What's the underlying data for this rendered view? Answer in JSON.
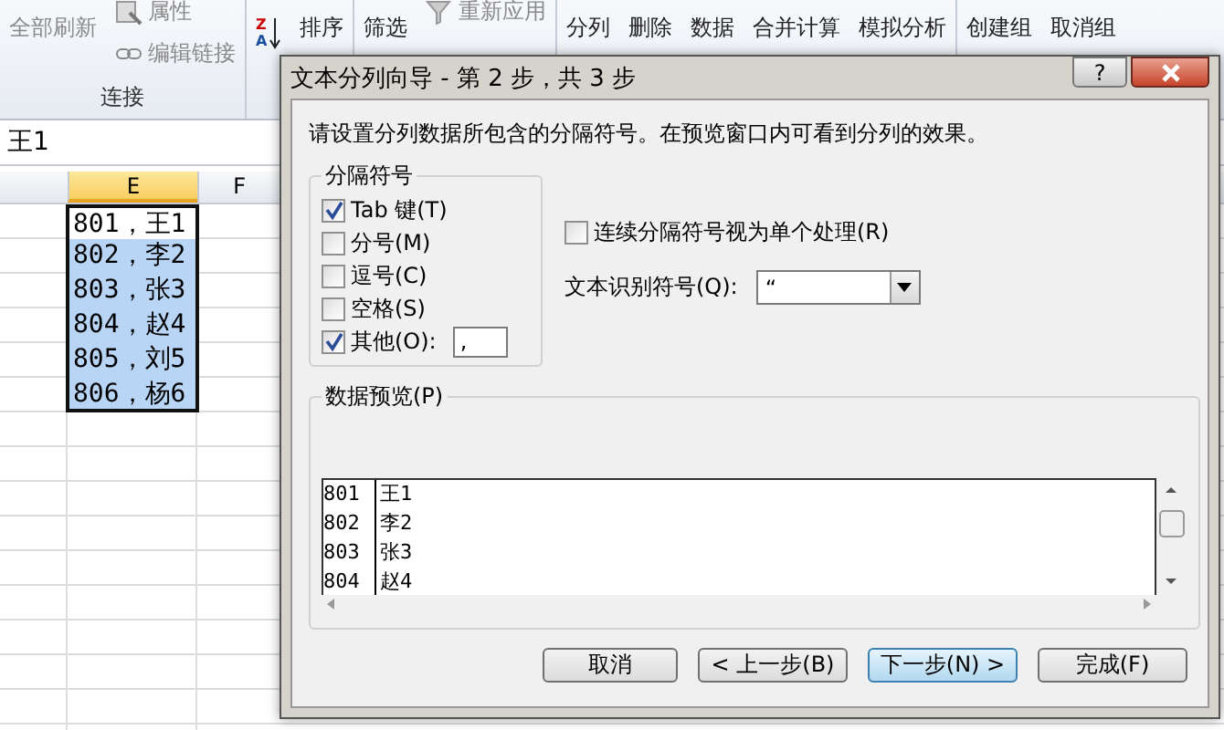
{
  "ribbon": {
    "groups": [
      {
        "label": "连接",
        "items": [
          {
            "kind": "large",
            "label": "全部刷新",
            "disabled": true
          },
          {
            "kind": "stack",
            "items": [
              {
                "label": "属性",
                "disabled": true
              },
              {
                "label": "编辑链接",
                "disabled": true
              }
            ]
          }
        ]
      },
      {
        "items": [
          {
            "kind": "sorticon",
            "top": "Z",
            "bottom": "A"
          },
          {
            "kind": "large",
            "label": "排序",
            "disabled": false
          }
        ]
      },
      {
        "items": [
          {
            "kind": "large",
            "label": "筛选",
            "disabled": false
          },
          {
            "kind": "stack",
            "items": [
              {
                "label": "重新应用",
                "disabled": true
              }
            ]
          }
        ]
      },
      {
        "items": [
          {
            "kind": "large",
            "label": "分列",
            "disabled": false
          },
          {
            "kind": "large",
            "label": "删除",
            "disabled": false
          },
          {
            "kind": "large",
            "label": "数据",
            "disabled": false
          },
          {
            "kind": "large",
            "label": "合并计算",
            "disabled": false
          },
          {
            "kind": "large",
            "label": "模拟分析",
            "disabled": false
          }
        ]
      },
      {
        "items": [
          {
            "kind": "large",
            "label": "创建组",
            "disabled": false
          },
          {
            "kind": "large",
            "label": "取消组",
            "disabled": false
          }
        ]
      }
    ]
  },
  "formula_bar": {
    "value": "王1"
  },
  "sheet": {
    "columns": [
      {
        "label": "E",
        "selected": true
      },
      {
        "label": "F",
        "selected": false
      }
    ],
    "cells": [
      {
        "text": "801，王1",
        "active": true
      },
      {
        "text": "802，李2",
        "active": false
      },
      {
        "text": "803，张3",
        "active": false
      },
      {
        "text": "804，赵4",
        "active": false
      },
      {
        "text": "805，刘5",
        "active": false
      },
      {
        "text": "806，杨6",
        "active": false
      }
    ]
  },
  "dialog": {
    "title": "文本分列向导 - 第 2 步，共 3 步",
    "help_button": "?",
    "instruction": "请设置分列数据所包含的分隔符号。在预览窗口内可看到分列的效果。",
    "delimiters": {
      "title": "分隔符号",
      "options": [
        {
          "label": "Tab 键(T)",
          "checked": true
        },
        {
          "label": "分号(M)",
          "checked": false
        },
        {
          "label": "逗号(C)",
          "checked": false
        },
        {
          "label": "空格(S)",
          "checked": false
        },
        {
          "label": "其他(O):",
          "checked": true,
          "value": ","
        }
      ]
    },
    "consecutive": {
      "label": "连续分隔符号视为单个处理(R)",
      "checked": false
    },
    "qualifier": {
      "label": "文本识别符号(Q):",
      "value": "“"
    },
    "preview": {
      "title": "数据预览(P)",
      "rows": [
        [
          "801",
          "王1"
        ],
        [
          "802",
          "李2"
        ],
        [
          "803",
          "张3"
        ],
        [
          "804",
          "赵4"
        ]
      ]
    },
    "buttons": [
      {
        "label": "取消",
        "focused": false
      },
      {
        "label": "< 上一步(B)",
        "focused": false
      },
      {
        "label": "下一步(N) >",
        "focused": true
      },
      {
        "label": "完成(F)",
        "focused": false
      }
    ]
  }
}
